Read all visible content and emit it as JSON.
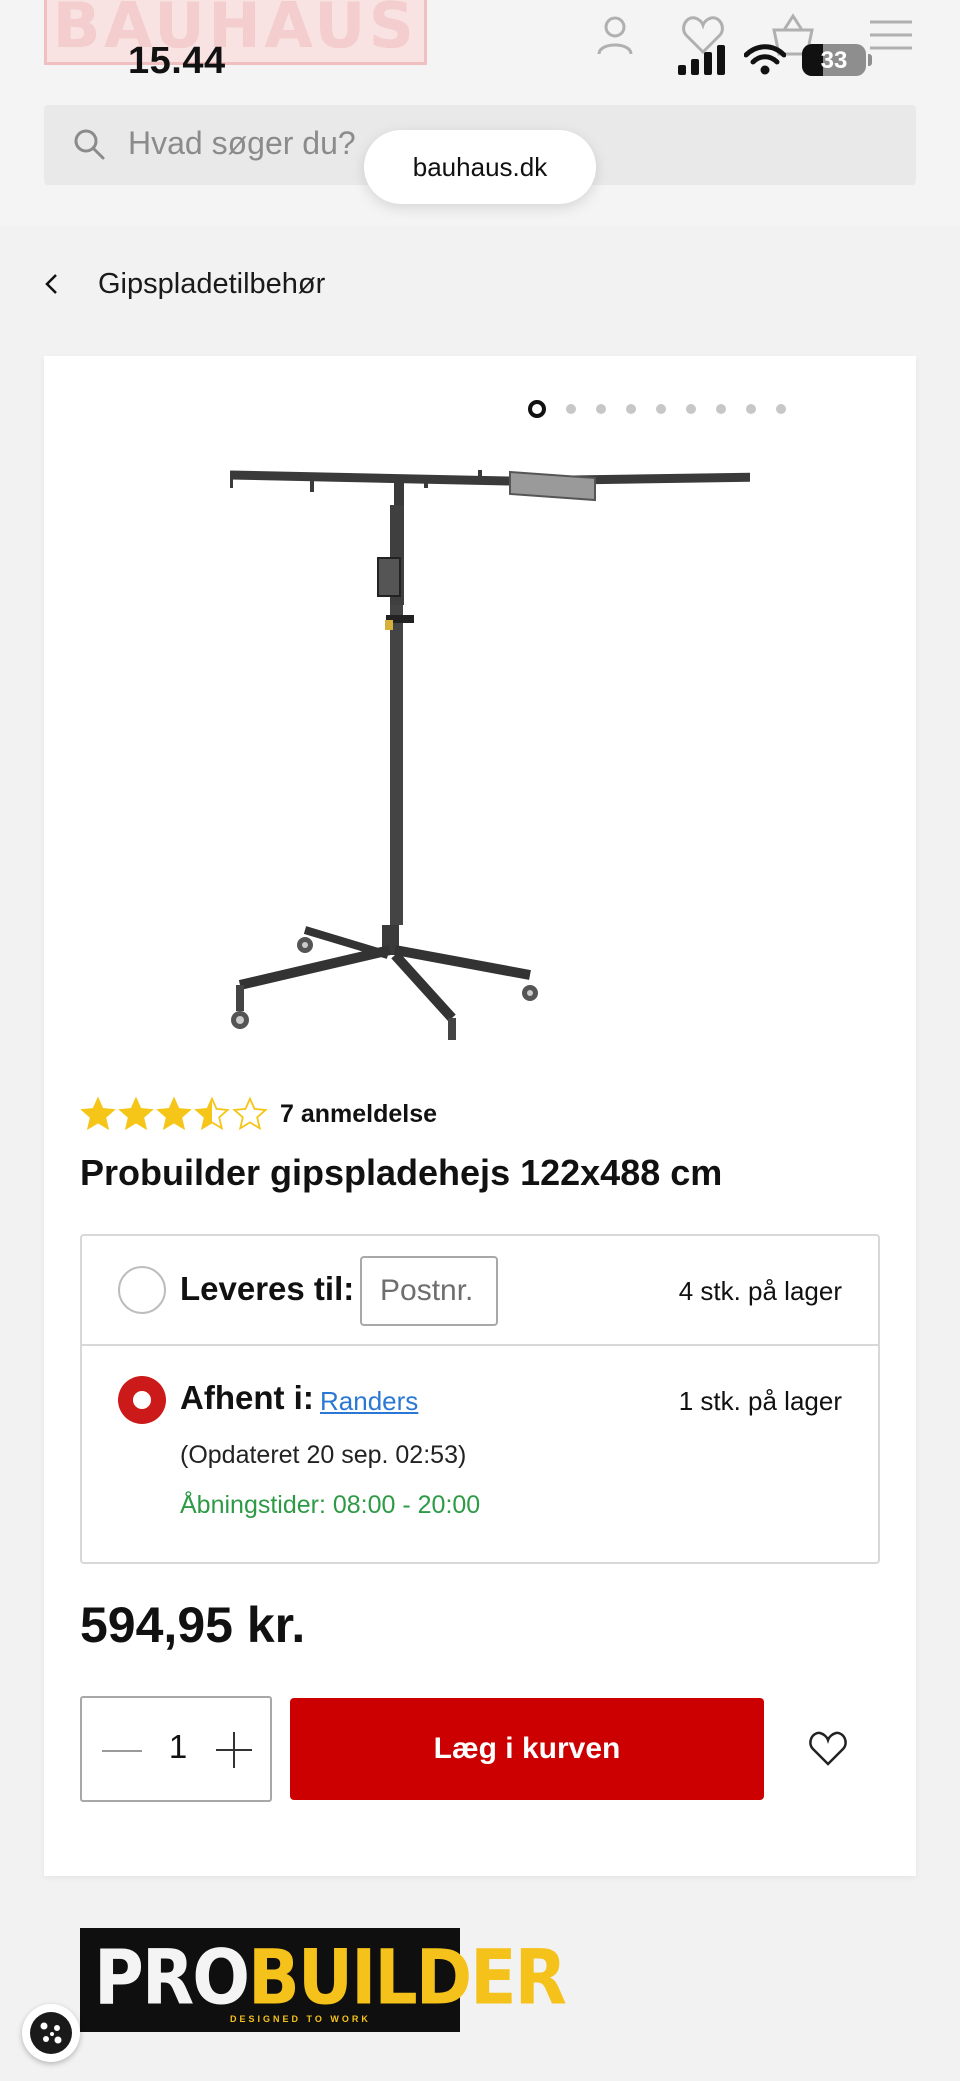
{
  "status_bar": {
    "time": "15.44",
    "battery": "33",
    "battery_level": 0.33
  },
  "header": {
    "logo_text": "BAUHAUS",
    "search_placeholder": "Hvad søger du?",
    "url": "bauhaus.dk",
    "icons": [
      "user-icon",
      "heart-icon",
      "basket-icon",
      "menu-icon"
    ]
  },
  "breadcrumb": {
    "label": "Gipspladetilbehør"
  },
  "gallery": {
    "image_count": 9,
    "active_index": 0
  },
  "product": {
    "rating": 3.5,
    "review_count_label": "7 anmeldelse",
    "title": "Probuilder gipspladehejs 122x488 cm",
    "price": "594,95 kr."
  },
  "delivery": {
    "label": "Leveres til:",
    "postcode_placeholder": "Postnr.",
    "stock": "4 stk. på lager"
  },
  "pickup": {
    "label": "Afhent i:",
    "store": "Randers",
    "stock": "1 stk. på lager",
    "updated": "(Opdateret 20 sep. 02:53)",
    "hours": "Åbningstider: 08:00 - 20:00"
  },
  "purchase": {
    "quantity": "1",
    "add_to_cart_label": "Læg i kurven"
  },
  "brand": {
    "name_white": "PRO",
    "name_yellow": "BUILDER",
    "tagline": "DESIGNED TO WORK"
  },
  "colors": {
    "accent": "#cc0000",
    "star": "#f5c518",
    "link": "#2b78d4",
    "open_hours": "#2e9a46"
  }
}
